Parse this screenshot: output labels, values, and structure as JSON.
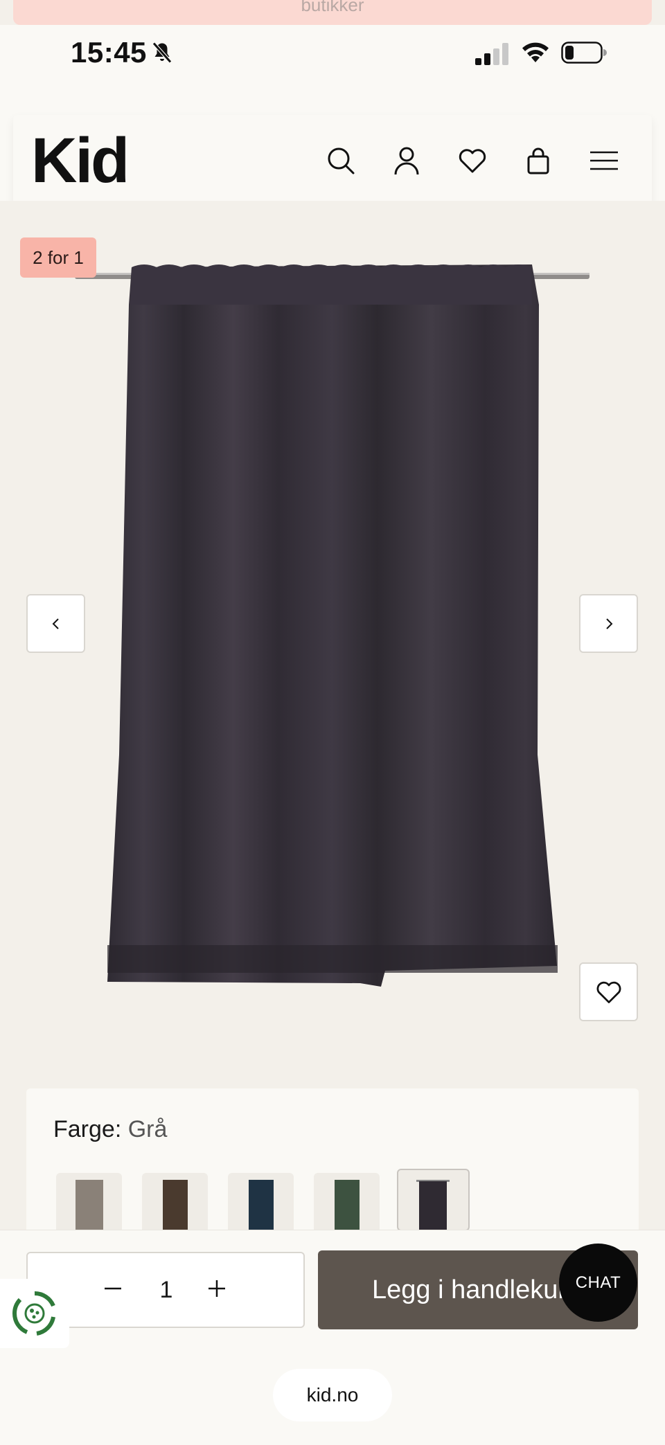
{
  "banner": {
    "text": "butikker"
  },
  "status_bar": {
    "time": "15:45"
  },
  "header": {
    "logo": "Kid",
    "icons": [
      "search-icon",
      "account-icon",
      "wishlist-icon",
      "bag-icon",
      "menu-icon"
    ]
  },
  "product": {
    "badge": "2 for 1",
    "prev_label": "‹",
    "next_label": "›"
  },
  "color_selector": {
    "label": "Farge:",
    "value": "Grå",
    "swatches": [
      {
        "name": "beige",
        "color": "#8a8178"
      },
      {
        "name": "brown",
        "color": "#4a3a2e"
      },
      {
        "name": "navy",
        "color": "#1f3344"
      },
      {
        "name": "green",
        "color": "#3d5240"
      },
      {
        "name": "grå",
        "color": "#2f2a32",
        "selected": true
      }
    ]
  },
  "cart": {
    "quantity": "1",
    "add_label": "Legg i handlekurv",
    "chat_label": "CHAT"
  },
  "browser": {
    "url": "kid.no"
  },
  "colors": {
    "badge": "#f8b4a8",
    "add_button": "#5d554e",
    "curtain": "#37323b"
  }
}
